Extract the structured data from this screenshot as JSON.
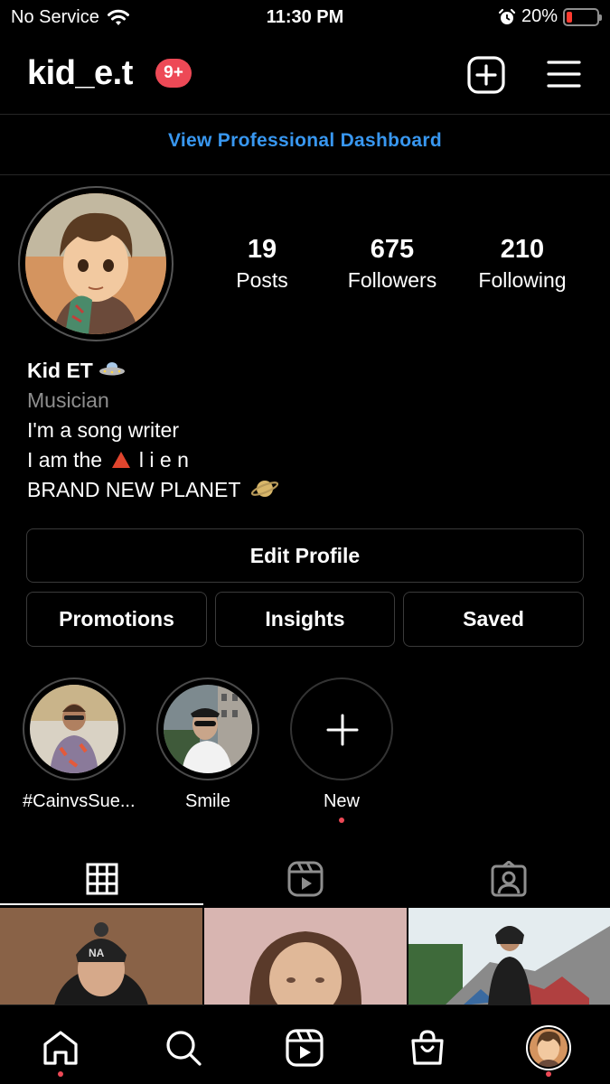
{
  "status_bar": {
    "carrier": "No Service",
    "time": "11:30 PM",
    "battery_percent": "20%",
    "battery_level": 0.2
  },
  "header": {
    "username": "kid_e.t",
    "notification_badge": "9+",
    "icons": [
      "new-post-icon",
      "menu-icon"
    ]
  },
  "dashboard_link": "View Professional Dashboard",
  "profile": {
    "stats": [
      {
        "value": "19",
        "label": "Posts"
      },
      {
        "value": "675",
        "label": "Followers"
      },
      {
        "value": "210",
        "label": "Following"
      }
    ],
    "name": "Kid ET",
    "category": "Musician",
    "bio": {
      "line1": "I'm a song writer",
      "line2_start": "I am the",
      "line2_end": "l i e n",
      "line3": "BRAND NEW PLANET"
    }
  },
  "buttons": {
    "edit_profile": "Edit Profile",
    "promotions": "Promotions",
    "insights": "Insights",
    "saved": "Saved"
  },
  "highlights": [
    {
      "label": "#CainvsSue..."
    },
    {
      "label": "Smile"
    },
    {
      "label": "New"
    }
  ],
  "tabs": [
    "grid-tab",
    "reels-tab",
    "tagged-tab"
  ],
  "colors": {
    "background": "#000000",
    "link_blue": "#3897f0",
    "badge_red": "#ed4956",
    "muted_text": "#8e8e8e"
  }
}
